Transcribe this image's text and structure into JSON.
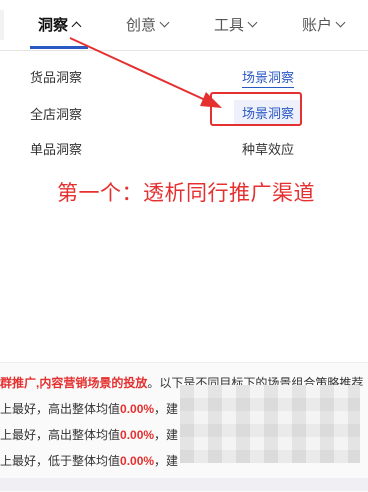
{
  "nav": {
    "items": [
      {
        "label": "洞察",
        "active": true
      },
      {
        "label": "创意",
        "active": false
      },
      {
        "label": "工具",
        "active": false
      },
      {
        "label": "账户",
        "active": false
      }
    ]
  },
  "menu": {
    "left": [
      "货品洞察",
      "全店洞察",
      "单品洞察"
    ],
    "right": [
      "场景洞察",
      "场景洞察",
      "种草效应"
    ]
  },
  "annotation": {
    "caption": "第一个：透析同行推广渠道",
    "color": "#e53030"
  },
  "panel": {
    "intro": {
      "highlight": "群推广,内容营销场景的投放",
      "rest": "。以下是不同目标下的场景组合策略推荐"
    },
    "rows": [
      {
        "prefix": "上最好，高出整体均值",
        "value": "0.00%",
        "suffix": "，建"
      },
      {
        "prefix": "上最好，高出整体均值",
        "value": "0.00%",
        "suffix": "，建"
      },
      {
        "prefix": "上最好，低于整体均值",
        "value": "0.00%",
        "suffix": "，建"
      }
    ]
  },
  "colors": {
    "accent": "#2b59c3",
    "annotation_red": "#e53030"
  }
}
